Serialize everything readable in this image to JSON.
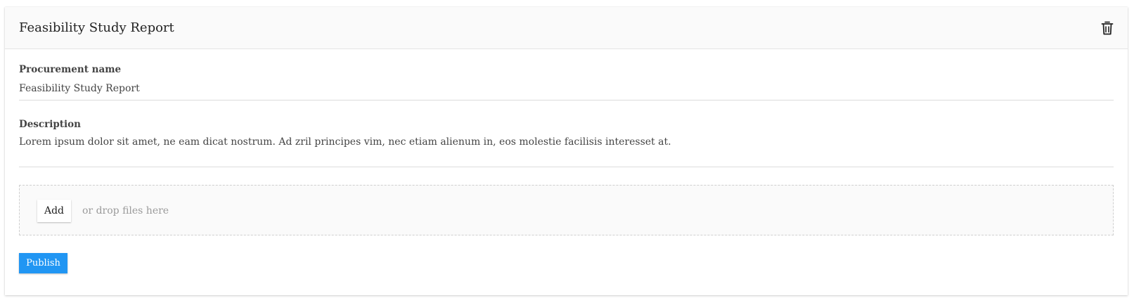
{
  "card": {
    "title": "Feasibility Study Report",
    "delete_icon": "trash-icon"
  },
  "fields": {
    "procurement_name": {
      "label": "Procurement name",
      "value": "Feasibility Study Report"
    },
    "description": {
      "label": "Description",
      "value": "Lorem ipsum dolor sit amet, ne eam dicat nostrum. Ad zril principes vim, nec etiam alienum in, eos molestie facilisis interesset at."
    }
  },
  "dropzone": {
    "add_label": "Add",
    "hint": "or drop files here"
  },
  "actions": {
    "publish_label": "Publish"
  },
  "colors": {
    "primary": "#2196f3",
    "header_bg": "#fafafa",
    "dropzone_bg": "#fafafa",
    "text": "#333333",
    "muted": "#9a9a9a"
  }
}
